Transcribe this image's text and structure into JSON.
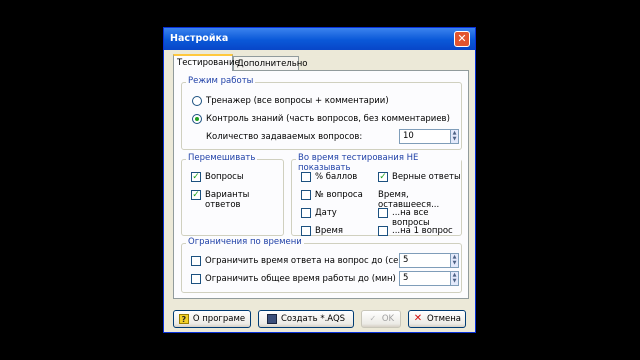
{
  "window": {
    "title": "Настройка"
  },
  "tabs": [
    {
      "label": "Тестирование"
    },
    {
      "label": "Дополнительно"
    }
  ],
  "mode": {
    "title": "Режим работы",
    "options": [
      {
        "label": "Тренажер (все вопросы + комментарии)",
        "selected": false
      },
      {
        "label": "Контроль знаний (часть вопросов, без комментариев)",
        "selected": true
      }
    ],
    "count_label": "Количество задаваемых вопросов:",
    "count_value": "10"
  },
  "shuffle": {
    "title": "Перемешивать",
    "items": [
      {
        "label": "Вопросы",
        "checked": true
      },
      {
        "label": "Варианты ответов",
        "checked": true
      }
    ]
  },
  "hide": {
    "title": "Во время тестирования НЕ показывать",
    "items": [
      {
        "label": "% баллов",
        "checked": false
      },
      {
        "label": "Верные ответы",
        "checked": true
      },
      {
        "label": "№ вопроса",
        "checked": false
      },
      {
        "label": "Время, оставшееся..."
      },
      {
        "label": "Дату",
        "checked": false
      },
      {
        "label": "...на все вопросы",
        "checked": false
      },
      {
        "label": "Время",
        "checked": false
      },
      {
        "label": "...на 1 вопрос",
        "checked": false
      }
    ]
  },
  "limits": {
    "title": "Ограничения по времени",
    "items": [
      {
        "label": "Ограничить время ответа на вопрос до (сек)",
        "checked": false,
        "value": "5"
      },
      {
        "label": "Ограничить общее время работы до (мин)",
        "checked": false,
        "value": "5"
      }
    ]
  },
  "buttons": {
    "about": "О програме",
    "create": "Создать *.AQS",
    "ok": "OK",
    "cancel": "Отмена"
  },
  "colors": {
    "titlebar": "#0a58d8",
    "close": "#e2552f",
    "check": "#21a121",
    "group_label": "#2142a8"
  }
}
